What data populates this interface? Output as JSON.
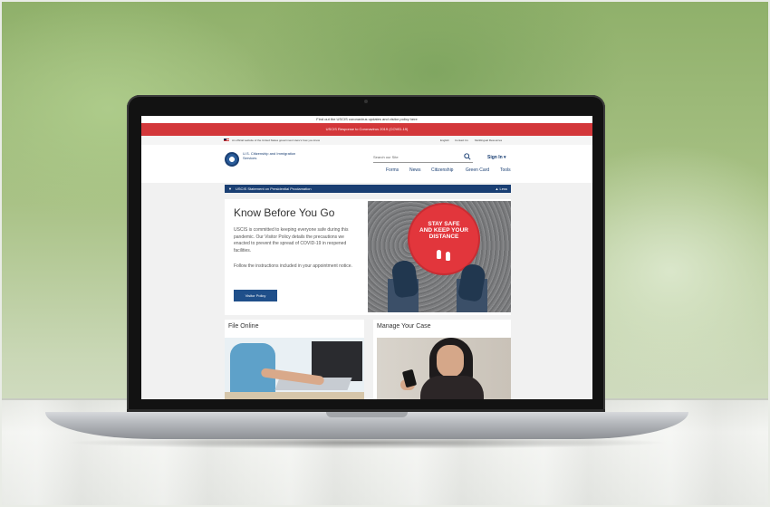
{
  "site": {
    "top_bar": "Find out the USCIS coronavirus updates and visitor policy here",
    "alert_bar": "USCIS Response to Coronavirus 2019 (COVID-19)",
    "gov_banner": "An official website of the United States government  Here's how you know",
    "utility_links": [
      "English",
      "Contact Us",
      "Multilingual Resources"
    ],
    "agency_name": "U.S. Citizenship and Immigration Services",
    "search_placeholder": "Search our Site",
    "sign_in": "Sign In ▾",
    "nav": [
      "Forms",
      "News",
      "Citizenship",
      "Green Card",
      "Tools"
    ],
    "statement_banner": "USCIS Statement on Presidential Proclamation",
    "statement_more": "▲ Less",
    "feature": {
      "title": "Know Before You Go",
      "body": "USCIS is committed to keeping everyone safe during this pandemic. Our Visitor Policy details the precautions we enacted to prevent the spread of COVID-19 in reopened facilities.",
      "follow": "Follow the instructions included in your appointment notice.",
      "button": "Visitor Policy",
      "sign_text_1": "STAY SAFE",
      "sign_text_2": "AND KEEP YOUR",
      "sign_text_3": "DISTANCE"
    },
    "cards": [
      {
        "title": "File Online"
      },
      {
        "title": "Manage Your Case"
      }
    ]
  },
  "colors": {
    "alert_red": "#d3373a",
    "navy": "#1a3f73",
    "button_blue": "#1f4f8a",
    "sign_red": "#e2363c"
  }
}
